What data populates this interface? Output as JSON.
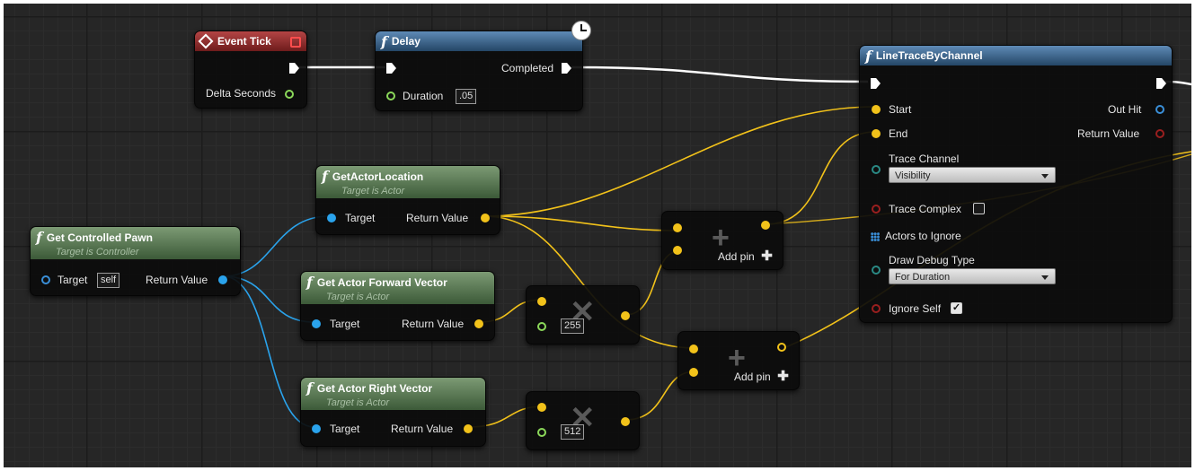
{
  "nodes": {
    "event_tick": {
      "title": "Event Tick",
      "delta_seconds": "Delta Seconds"
    },
    "delay": {
      "title": "Delay",
      "completed": "Completed",
      "duration_label": "Duration",
      "duration_value": ".05"
    },
    "line_trace": {
      "title": "LineTraceByChannel",
      "start": "Start",
      "end": "End",
      "out_hit": "Out Hit",
      "return_value": "Return Value",
      "trace_channel_label": "Trace Channel",
      "trace_channel_value": "Visibility",
      "trace_complex": "Trace Complex",
      "actors_to_ignore": "Actors to Ignore",
      "draw_debug_label": "Draw Debug Type",
      "draw_debug_value": "For Duration",
      "ignore_self": "Ignore Self"
    },
    "get_actor_location": {
      "title": "GetActorLocation",
      "subtitle": "Target is Actor",
      "target": "Target",
      "return_value": "Return Value"
    },
    "get_controlled_pawn": {
      "title": "Get Controlled Pawn",
      "subtitle": "Target is Controller",
      "target": "Target",
      "self_value": "self",
      "return_value": "Return Value"
    },
    "get_forward_vector": {
      "title": "Get Actor Forward Vector",
      "subtitle": "Target is Actor",
      "target": "Target",
      "return_value": "Return Value"
    },
    "get_right_vector": {
      "title": "Get Actor Right Vector",
      "subtitle": "Target is Actor",
      "target": "Target",
      "return_value": "Return Value"
    },
    "multiply_1": {
      "value": "255",
      "op": "✕"
    },
    "multiply_2": {
      "value": "512",
      "op": "✕"
    },
    "add_1": {
      "add_pin": "Add pin",
      "op": "+"
    },
    "add_2": {
      "add_pin": "Add pin",
      "op": "+"
    }
  },
  "colors": {
    "exec": "#ffffff",
    "vector_pin": "#f2c21a",
    "object_pin": "#2aa3ec",
    "float_pin": "#8bd85a",
    "bool_pin": "#9a1f1f"
  },
  "icons": {
    "event": "diamond-icon",
    "function": "function-icon",
    "latent": "clock-icon",
    "array": "array-grid-icon",
    "add": "plus-icon"
  }
}
